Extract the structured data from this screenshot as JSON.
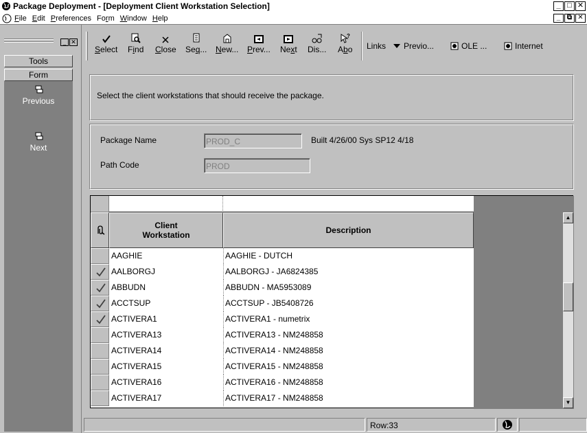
{
  "window": {
    "title": "Package Deployment - [Deployment Client Workstation Selection]"
  },
  "menu": {
    "items": [
      {
        "label": "File",
        "u": "F",
        "rest": "ile"
      },
      {
        "label": "Edit",
        "u": "E",
        "rest": "dit"
      },
      {
        "label": "Preferences",
        "u": "P",
        "rest": "references"
      },
      {
        "label": "Form",
        "pre": "Fo",
        "u": "r",
        "rest": "m"
      },
      {
        "label": "Window",
        "u": "W",
        "rest": "indow"
      },
      {
        "label": "Help",
        "u": "H",
        "rest": "elp"
      }
    ]
  },
  "left_pane": {
    "tools_label": "Tools",
    "form_label": "Form",
    "previous_label": "Previous",
    "next_label": "Next"
  },
  "toolbar": {
    "select": {
      "u": "S",
      "rest": "elect"
    },
    "find": {
      "pre": "F",
      "u": "i",
      "rest": "nd"
    },
    "close": {
      "u": "C",
      "rest": "lose"
    },
    "seq": {
      "pre": "Se",
      "u": "q",
      "rest": "..."
    },
    "new": {
      "u": "N",
      "rest": "ew..."
    },
    "prev": {
      "u": "P",
      "rest": "rev..."
    },
    "next": {
      "pre": "Ne",
      "u": "x",
      "rest": "t"
    },
    "dis": {
      "label": "Dis..."
    },
    "abo": {
      "pre": "A",
      "u": "b",
      "rest": "o"
    },
    "links_label": "Links",
    "previo_label": "Previo...",
    "ole_label": "OLE ...",
    "internet_label": "Internet"
  },
  "form": {
    "instruction": "Select the client workstations that should receive the package.",
    "package_name_label": "Package Name",
    "package_name_value": "PROD_C",
    "build_info": "Built 4/26/00  Sys SP12 4/18",
    "path_code_label": "Path Code",
    "path_code_value": "PROD"
  },
  "grid": {
    "columns": [
      "Client\nWorkstation",
      "Description"
    ],
    "rows": [
      {
        "workstation": "AAGHIE",
        "description": "AAGHIE - DUTCH",
        "checked": false
      },
      {
        "workstation": "AALBORGJ",
        "description": "AALBORGJ - JA6824385",
        "checked": true
      },
      {
        "workstation": "ABBUDN",
        "description": "ABBUDN - MA5953089",
        "checked": true
      },
      {
        "workstation": "ACCTSUP",
        "description": "ACCTSUP - JB5408726",
        "checked": true
      },
      {
        "workstation": "ACTIVERA1",
        "description": "ACTIVERA1 - numetrix",
        "checked": true
      },
      {
        "workstation": "ACTIVERA13",
        "description": "ACTIVERA13 - NM248858",
        "checked": false
      },
      {
        "workstation": "ACTIVERA14",
        "description": "ACTIVERA14 - NM248858",
        "checked": false
      },
      {
        "workstation": "ACTIVERA15",
        "description": "ACTIVERA15 - NM248858",
        "checked": false
      },
      {
        "workstation": "ACTIVERA16",
        "description": "ACTIVERA16 - NM248858",
        "checked": false
      },
      {
        "workstation": "ACTIVERA17",
        "description": "ACTIVERA17 - NM248858",
        "checked": false
      }
    ]
  },
  "status": {
    "row_text": "Row:33"
  }
}
